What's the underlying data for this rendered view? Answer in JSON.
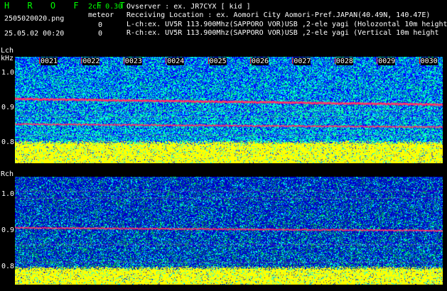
{
  "header": {
    "app_name": "H R O F F T",
    "channel_setting": "2ch 0.30",
    "mode": "meteor",
    "filename": "2505020020.png",
    "count_l": "0",
    "datetime": "25.05.02 00:20",
    "count_r": "0",
    "observer": "Ovserver              : ex. JR7CYX [ kid ]",
    "location": "Receiving Location : ex. Aomori City Aomori-Pref.JAPAN(40.49N, 140.47E)",
    "lch_info": "L-ch:ex. UV5R 113.900Mhz(SAPPORO VOR)USB ,2-ele yagi (Holozontal 10m height",
    "rch_info": "R-ch:ex. UV5R 113.900Mhz(SAPPORO VOR)USB ,2-ele yagi (Vertical 10m height"
  },
  "lch_panel": {
    "channel_label": "Lch",
    "unit_label": "kHz",
    "y_ticks": [
      "1.0",
      "0.9",
      "0.8"
    ],
    "time_labels": [
      "0021",
      "0022",
      "0023",
      "0024",
      "0025",
      "0026",
      "0027",
      "0028",
      "0029",
      "0030"
    ],
    "spectrum_colors": {
      "background": "#0000ff",
      "noise_high": "#00ffff",
      "noise_mid": "#00ff80",
      "carrier": "#ff3366",
      "floor": "#ffff00"
    }
  },
  "rch_panel": {
    "channel_label": "Rch",
    "y_ticks": [
      "1.0",
      "0.9",
      "0.8"
    ],
    "spectrum_colors": {
      "background": "#0000cc",
      "noise_high": "#00ffff",
      "noise_mid": "#00c040",
      "carrier": "#ff3366",
      "floor": "#ffff00"
    }
  }
}
